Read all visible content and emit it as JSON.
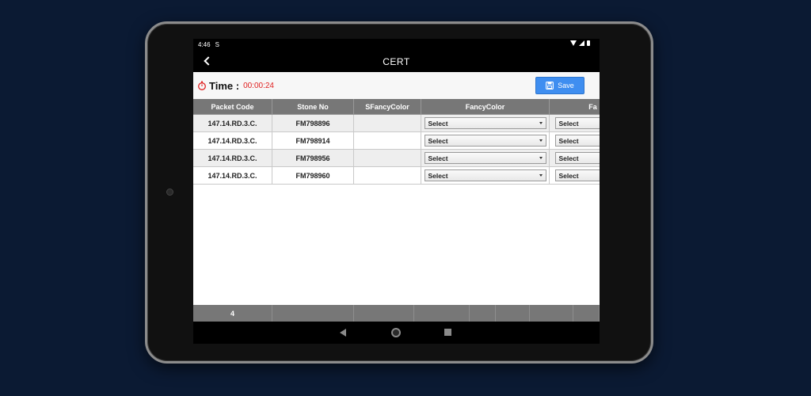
{
  "statusbar": {
    "time": "4:46",
    "app_icon": "S"
  },
  "appbar": {
    "title": "CERT"
  },
  "toolbar": {
    "time_label": "Time :",
    "time_value": "00:00:24",
    "save_label": "Save"
  },
  "table": {
    "headers": [
      "Packet Code",
      "Stone No",
      "SFancyColor",
      "FancyColor",
      "Fa"
    ],
    "rows": [
      {
        "packet_code": "147.14.RD.3.C.",
        "stone_no": "FM798896",
        "sfancycolor": "",
        "fancycolor": "Select",
        "fa": "Select"
      },
      {
        "packet_code": "147.14.RD.3.C.",
        "stone_no": "FM798914",
        "sfancycolor": "",
        "fancycolor": "Select",
        "fa": "Select"
      },
      {
        "packet_code": "147.14.RD.3.C.",
        "stone_no": "FM798956",
        "sfancycolor": "",
        "fancycolor": "Select",
        "fa": "Select"
      },
      {
        "packet_code": "147.14.RD.3.C.",
        "stone_no": "FM798960",
        "sfancycolor": "",
        "fancycolor": "Select",
        "fa": "Select"
      }
    ],
    "footer_count": "4"
  },
  "colors": {
    "accent": "#3f8ef0",
    "timer": "#e02020",
    "header_bg": "#777777",
    "page_bg": "#0b1a33"
  }
}
